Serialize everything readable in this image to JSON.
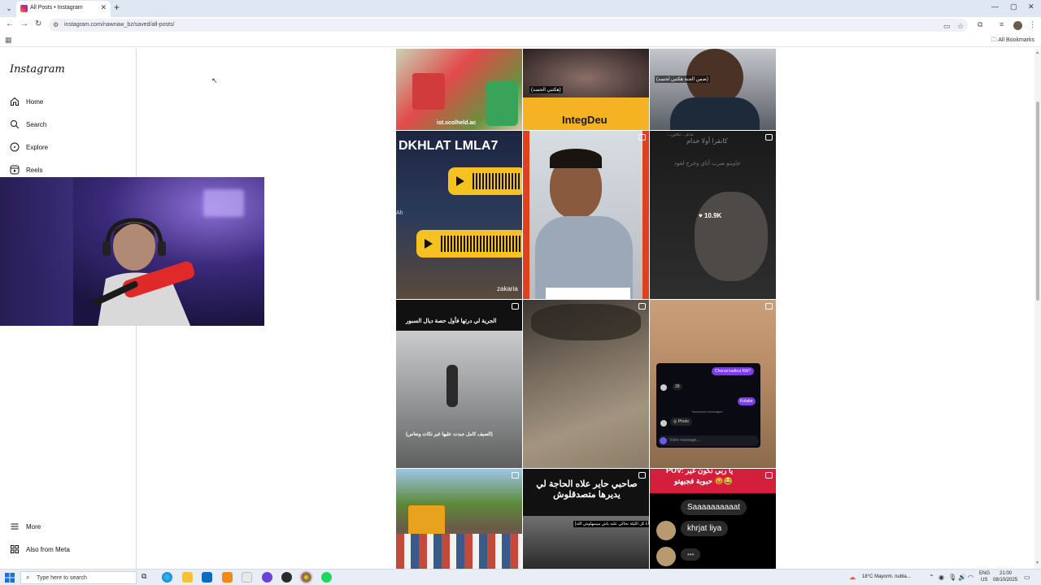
{
  "browser": {
    "tab": {
      "title": "All Posts • Instagram",
      "close": "✕"
    },
    "new_tab": "+",
    "address": "instagram.com/nawnaw_bz/saved/all-posts/",
    "window_controls": {
      "minimize": "—",
      "maximize": "▢",
      "close": "✕"
    },
    "nav": {
      "back": "←",
      "forward": "→",
      "reload": "↻"
    },
    "all_bookmarks": "All Bookmarks"
  },
  "sidebar": {
    "logo": "Instagram",
    "items": [
      {
        "label": "Home",
        "icon": "home-icon"
      },
      {
        "label": "Search",
        "icon": "search-icon"
      },
      {
        "label": "Explore",
        "icon": "compass-icon"
      },
      {
        "label": "Reels",
        "icon": "reels-icon"
      }
    ],
    "bottom_items": [
      {
        "label": "More",
        "icon": "menu-icon"
      },
      {
        "label": "Also from Meta",
        "icon": "meta-icon"
      }
    ]
  },
  "posts": {
    "p1": {
      "text": "ist.scolheld.ac"
    },
    "p2": {
      "caption": "(هكتبي الحسد)",
      "brand": "IntegDeu"
    },
    "p3": {
      "caption": "(ضمن الجنة هكتبي لحسد)"
    },
    "p4": {
      "headline": "DKHLAT LMLA7",
      "side": "Ah",
      "credit": "zakaria"
    },
    "p6": {
      "top1": "...ندم...تخي",
      "top2": "كانقرا أولا خدام",
      "top3": "جاوبتو شرب أتاي وخرج لقود",
      "likes": "10.9K"
    },
    "p7": {
      "top": "الجرية لي درتها فأول حصة ديال السبور",
      "bottom": "(الصيف كامل جبدت عليها غير تكات ونعاس)"
    },
    "p9": {
      "bubble1": "Chenai kadbui fi3k?",
      "count": "39",
      "bubble2": "Kolabe",
      "divider": "Nouveaux messages",
      "photo": "Photo",
      "input": "Votre message..."
    },
    "p11": {
      "headline": "صاحبي حاير علاه الحاجة لي يديرها متصدقلوش",
      "sub": "[أنا كل الليلة نحاكي عليه ياش ميسهلوش الله]"
    },
    "p12": {
      "top": "POV: يا ربي نكون غير",
      "top2": "حبوبة فجبهتو 😡😂",
      "b1": "Saaaaaaaaaat",
      "b2": "khrjat liya",
      "b3": "•••"
    }
  },
  "taskbar": {
    "search_placeholder": "Type here to search",
    "weather": "18°C  Mayorm. nubla...",
    "lang1": "ENG",
    "lang2": "US",
    "time": "21:00",
    "date": "08/10/2025"
  }
}
